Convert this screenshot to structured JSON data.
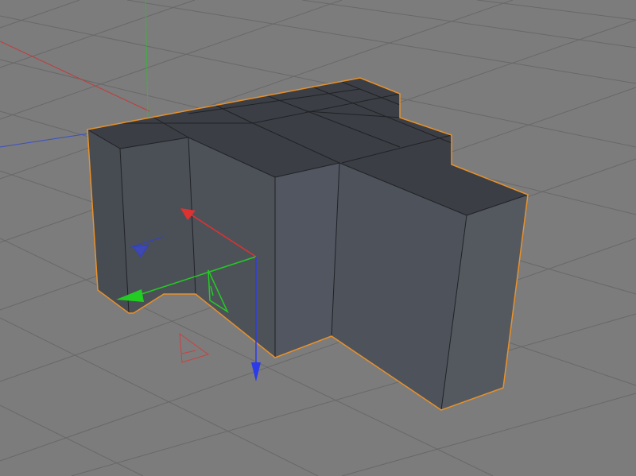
{
  "viewport": {
    "background": "#7c7c7c",
    "grid_color": "#686868"
  },
  "world_axes": {
    "x_color": "#c23b3b",
    "y_color": "#3fae3f",
    "z_color": "#3b4fc2"
  },
  "object": {
    "selected": true,
    "selection_color": "#e8912a",
    "top_face_color": "#3b3e44",
    "front_face_color": "#4b5057",
    "side_face_color": "#555a61",
    "edge_color": "#202226"
  },
  "gizmo": {
    "tool": "move",
    "x_handle_color": "#e03131",
    "y_handle_color": "#22cc22",
    "z_handle_color": "#2b3bea"
  }
}
